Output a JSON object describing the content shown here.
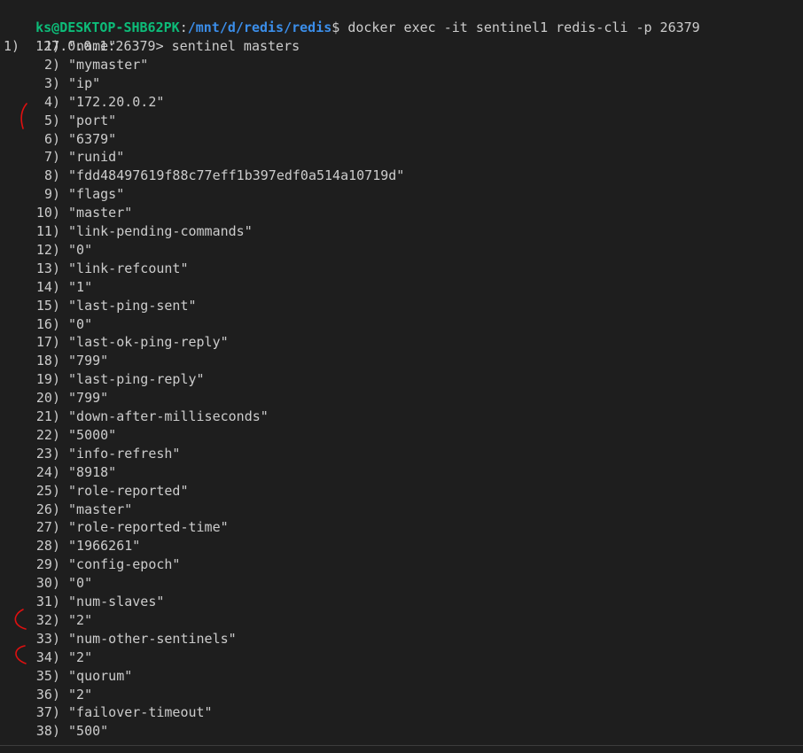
{
  "prompt": {
    "user_host": "ks@DESKTOP-SHB62PK",
    "separator": ":",
    "cwd": "/mnt/d/redis/redis",
    "symbol": "$",
    "command": " docker exec -it sentinel1 redis-cli -p 26379"
  },
  "cli": {
    "prompt": "127.0.0.1:26379>",
    "command": " sentinel masters"
  },
  "outer_index": "1)",
  "rows": [
    {
      "n": "1)",
      "v": "\"name\""
    },
    {
      "n": "2)",
      "v": "\"mymaster\""
    },
    {
      "n": "3)",
      "v": "\"ip\""
    },
    {
      "n": "4)",
      "v": "\"172.20.0.2\""
    },
    {
      "n": "5)",
      "v": "\"port\""
    },
    {
      "n": "6)",
      "v": "\"6379\""
    },
    {
      "n": "7)",
      "v": "\"runid\""
    },
    {
      "n": "8)",
      "v": "\"fdd48497619f88c77eff1b397edf0a514a10719d\""
    },
    {
      "n": "9)",
      "v": "\"flags\""
    },
    {
      "n": "10)",
      "v": "\"master\""
    },
    {
      "n": "11)",
      "v": "\"link-pending-commands\""
    },
    {
      "n": "12)",
      "v": "\"0\""
    },
    {
      "n": "13)",
      "v": "\"link-refcount\""
    },
    {
      "n": "14)",
      "v": "\"1\""
    },
    {
      "n": "15)",
      "v": "\"last-ping-sent\""
    },
    {
      "n": "16)",
      "v": "\"0\""
    },
    {
      "n": "17)",
      "v": "\"last-ok-ping-reply\""
    },
    {
      "n": "18)",
      "v": "\"799\""
    },
    {
      "n": "19)",
      "v": "\"last-ping-reply\""
    },
    {
      "n": "20)",
      "v": "\"799\""
    },
    {
      "n": "21)",
      "v": "\"down-after-milliseconds\""
    },
    {
      "n": "22)",
      "v": "\"5000\""
    },
    {
      "n": "23)",
      "v": "\"info-refresh\""
    },
    {
      "n": "24)",
      "v": "\"8918\""
    },
    {
      "n": "25)",
      "v": "\"role-reported\""
    },
    {
      "n": "26)",
      "v": "\"master\""
    },
    {
      "n": "27)",
      "v": "\"role-reported-time\""
    },
    {
      "n": "28)",
      "v": "\"1966261\""
    },
    {
      "n": "29)",
      "v": "\"config-epoch\""
    },
    {
      "n": "30)",
      "v": "\"0\""
    },
    {
      "n": "31)",
      "v": "\"num-slaves\""
    },
    {
      "n": "32)",
      "v": "\"2\""
    },
    {
      "n": "33)",
      "v": "\"num-other-sentinels\""
    },
    {
      "n": "34)",
      "v": "\"2\""
    },
    {
      "n": "35)",
      "v": "\"quorum\""
    },
    {
      "n": "36)",
      "v": "\"2\""
    },
    {
      "n": "37)",
      "v": "\"failover-timeout\""
    },
    {
      "n": "38)",
      "v": "\"500\""
    }
  ],
  "colors": {
    "background": "#1e1e1e",
    "text": "#cccccc",
    "user_host": "#0dbc79",
    "path": "#3b8eea",
    "annotation": "#e01010"
  }
}
